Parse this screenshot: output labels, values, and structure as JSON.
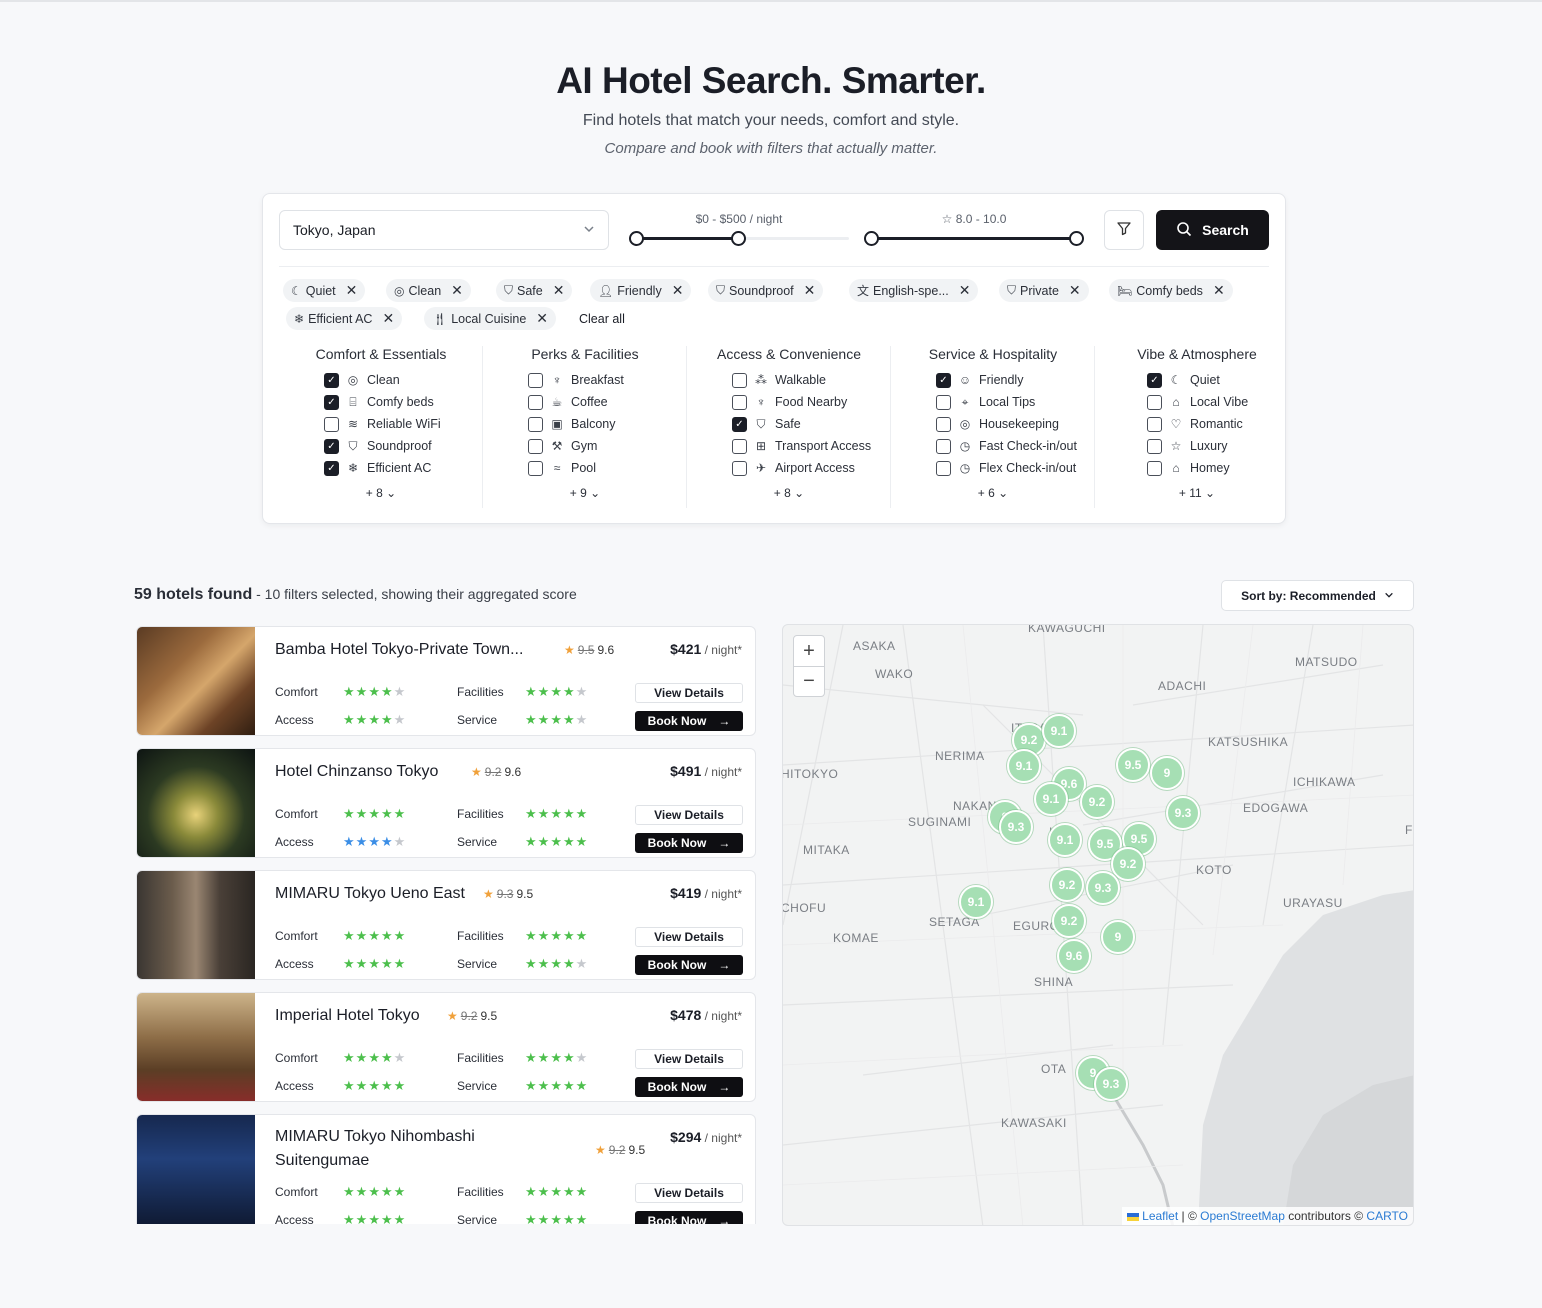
{
  "hero": {
    "title": "AI Hotel Search. Smarter.",
    "subtitle": "Find hotels that match your needs, comfort and style.",
    "tagline": "Compare and book with filters that actually matter."
  },
  "search": {
    "location": "Tokyo, Japan",
    "price_label": "$0 - $500 / night",
    "price_range": [
      0,
      500
    ],
    "rating_label": "8.0 - 10.0",
    "rating_range": [
      8.0,
      10.0
    ],
    "search_label": "Search"
  },
  "chips": [
    {
      "label": "Quiet",
      "icon": "moon-icon"
    },
    {
      "label": "Clean",
      "icon": "check-circle-icon"
    },
    {
      "label": "Safe",
      "icon": "shield-icon"
    },
    {
      "label": "Friendly",
      "icon": "user-icon"
    },
    {
      "label": "Soundproof",
      "icon": "shield-icon"
    },
    {
      "label": "English-spe...",
      "icon": "translate-icon"
    },
    {
      "label": "Private",
      "icon": "shield-check-icon"
    },
    {
      "label": "Comfy beds",
      "icon": "bed-icon"
    },
    {
      "label": "Efficient AC",
      "icon": "snowflake-icon"
    },
    {
      "label": "Local Cuisine",
      "icon": "utensils-icon"
    }
  ],
  "clear_all": "Clear all",
  "categories": [
    {
      "title": "Comfort & Essentials",
      "more": "+ 8",
      "items": [
        {
          "label": "Clean",
          "checked": true,
          "icon": "check-circle-icon"
        },
        {
          "label": "Comfy beds",
          "checked": true,
          "icon": "bed-icon"
        },
        {
          "label": "Reliable WiFi",
          "checked": false,
          "icon": "wifi-icon"
        },
        {
          "label": "Soundproof",
          "checked": true,
          "icon": "shield-icon"
        },
        {
          "label": "Efficient AC",
          "checked": true,
          "icon": "snowflake-icon"
        }
      ]
    },
    {
      "title": "Perks & Facilities",
      "more": "+ 9",
      "items": [
        {
          "label": "Breakfast",
          "checked": false,
          "icon": "utensils-icon"
        },
        {
          "label": "Coffee",
          "checked": false,
          "icon": "coffee-icon"
        },
        {
          "label": "Balcony",
          "checked": false,
          "icon": "balcony-icon"
        },
        {
          "label": "Gym",
          "checked": false,
          "icon": "dumbbell-icon"
        },
        {
          "label": "Pool",
          "checked": false,
          "icon": "waves-icon"
        }
      ]
    },
    {
      "title": "Access & Convenience",
      "more": "+ 8",
      "items": [
        {
          "label": "Walkable",
          "checked": false,
          "icon": "footprints-icon"
        },
        {
          "label": "Food Nearby",
          "checked": false,
          "icon": "utensils-icon"
        },
        {
          "label": "Safe",
          "checked": true,
          "icon": "shield-icon"
        },
        {
          "label": "Transport Access",
          "checked": false,
          "icon": "bus-icon"
        },
        {
          "label": "Airport Access",
          "checked": false,
          "icon": "plane-icon"
        }
      ]
    },
    {
      "title": "Service & Hospitality",
      "more": "+ 6",
      "items": [
        {
          "label": "Friendly",
          "checked": true,
          "icon": "user-icon"
        },
        {
          "label": "Local Tips",
          "checked": false,
          "icon": "map-pin-icon"
        },
        {
          "label": "Housekeeping",
          "checked": false,
          "icon": "check-circle-icon"
        },
        {
          "label": "Fast Check-in/out",
          "checked": false,
          "icon": "clock-icon"
        },
        {
          "label": "Flex Check-in/out",
          "checked": false,
          "icon": "clock-icon"
        }
      ]
    },
    {
      "title": "Vibe & Atmosphere",
      "more": "+ 11",
      "items": [
        {
          "label": "Quiet",
          "checked": true,
          "icon": "moon-icon"
        },
        {
          "label": "Local Vibe",
          "checked": false,
          "icon": "landmark-icon"
        },
        {
          "label": "Romantic",
          "checked": false,
          "icon": "heart-icon"
        },
        {
          "label": "Luxury",
          "checked": false,
          "icon": "star-icon"
        },
        {
          "label": "Homey",
          "checked": false,
          "icon": "home-icon"
        }
      ]
    }
  ],
  "results": {
    "count": "59 hotels found",
    "summary": " - 10 filters selected, showing their aggregated score",
    "sort_label": "Sort by: Recommended"
  },
  "labels": {
    "comfort": "Comfort",
    "facilities": "Facilities",
    "access": "Access",
    "service": "Service",
    "view_details": "View Details",
    "book_now": "Book Now",
    "per_night": " / night*"
  },
  "hotels": [
    {
      "name": "Bamba Hotel Tokyo-Private Town...",
      "old_score": "9.5",
      "score": "9.6",
      "price": "$421",
      "ratings": {
        "comfort": 4,
        "facilities": 4,
        "access": 4,
        "service": 4
      },
      "access_color": "green"
    },
    {
      "name": "Hotel Chinzanso Tokyo",
      "old_score": "9.2",
      "score": "9.6",
      "price": "$491",
      "ratings": {
        "comfort": 5,
        "facilities": 5,
        "access": 4,
        "service": 5
      },
      "access_color": "blue"
    },
    {
      "name": "MIMARU Tokyo Ueno East",
      "old_score": "9.3",
      "score": "9.5",
      "price": "$419",
      "ratings": {
        "comfort": 5,
        "facilities": 5,
        "access": 5,
        "service": 4
      },
      "access_color": "green"
    },
    {
      "name": "Imperial Hotel Tokyo",
      "old_score": "9.2",
      "score": "9.5",
      "price": "$478",
      "ratings": {
        "comfort": 4,
        "facilities": 4,
        "access": 5,
        "service": 5
      },
      "access_color": "green"
    },
    {
      "name": "MIMARU Tokyo Nihombashi Suitengumae",
      "old_score": "9.2",
      "score": "9.5",
      "price": "$294",
      "ratings": {
        "comfort": 5,
        "facilities": 5,
        "access": 5,
        "service": 5
      },
      "access_color": "green"
    }
  ],
  "map": {
    "places": [
      "KAWAGUCHI",
      "ASAKA",
      "WAKO",
      "MATSUDO",
      "ADACHI",
      "ITABASHI",
      "KATSUSHIKA",
      "NERIMA",
      "HITOKYO",
      "ICHIKAWA",
      "NAKANO",
      "EDOGAWA",
      "SUGINAMI",
      "MITAKA",
      "KOTO",
      "CHOFU",
      "SETAGA",
      "EGURO",
      "URAYASU",
      "KOMAE",
      "SHINA",
      "OTA",
      "KAWASAKI",
      "IKU",
      "F"
    ],
    "pins": [
      "9.2",
      "9.1",
      "9.1",
      "9.6",
      "9.1",
      "9.5",
      "9",
      "9.2",
      "9.3",
      "9",
      "9.3",
      "9.1",
      "9.5",
      "9.5",
      "9.2",
      "9.2",
      "9.3",
      "9.1",
      "9.2",
      "9",
      "9.6",
      "9",
      "9.3"
    ],
    "attribution": {
      "leaflet": "Leaflet",
      "sep": " | © ",
      "osm": "OpenStreetMap",
      "mid": " contributors © ",
      "carto": "CARTO"
    }
  }
}
